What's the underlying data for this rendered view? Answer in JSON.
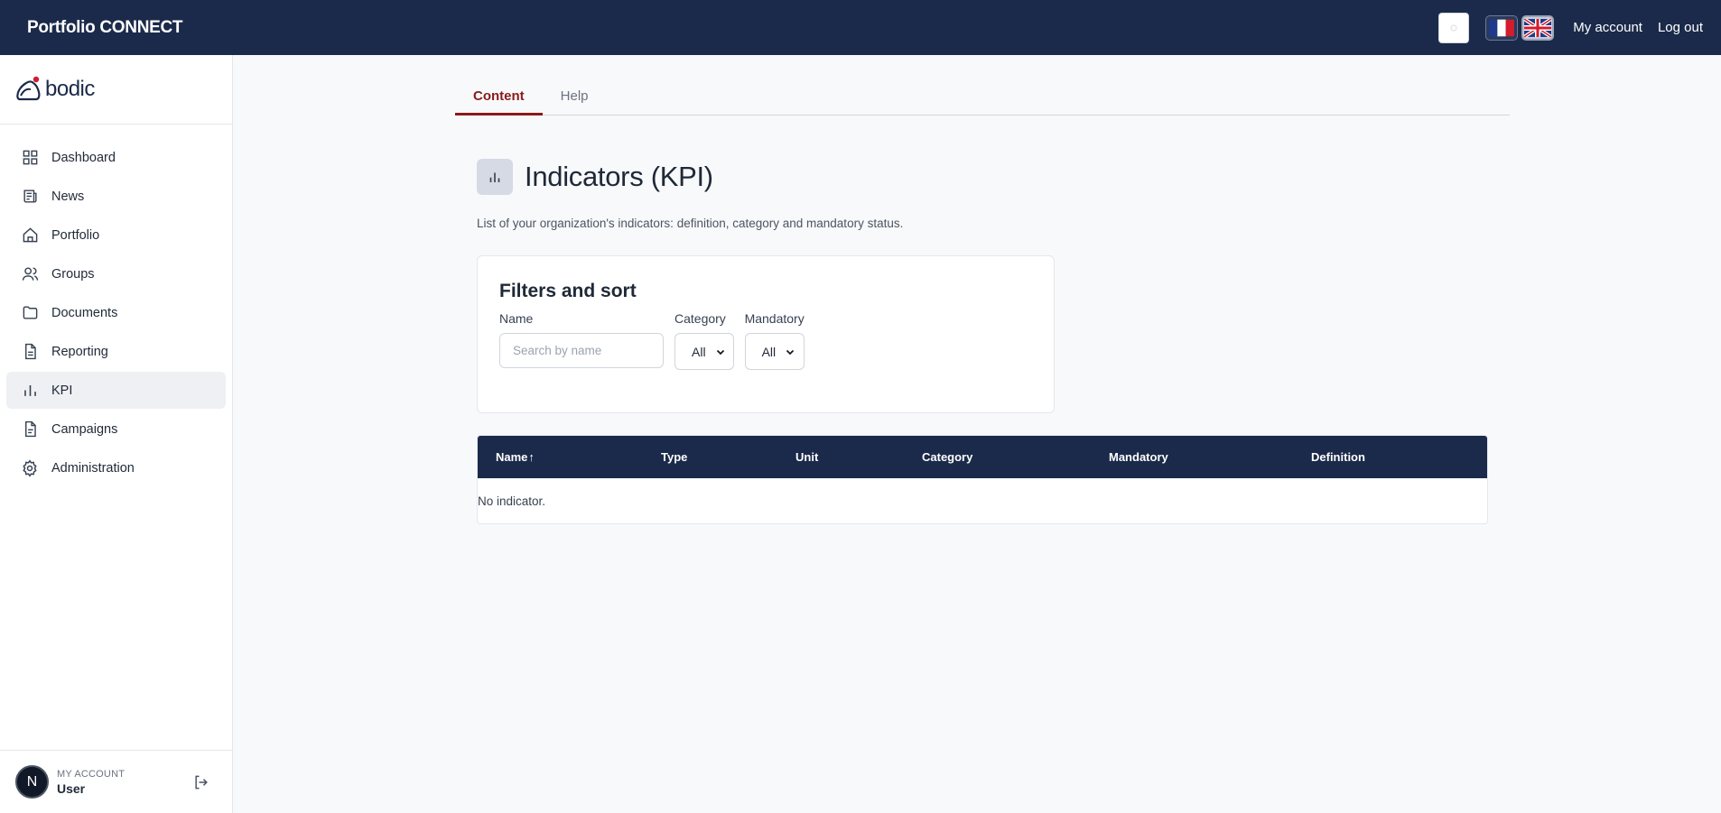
{
  "topbar": {
    "app_title": "Portfolio CONNECT",
    "my_account": "My account",
    "log_out": "Log out",
    "languages": [
      "fr",
      "en"
    ],
    "active_language": "en"
  },
  "sidebar": {
    "brand": "bodic",
    "items": [
      {
        "label": "Dashboard",
        "icon": "dashboard-grid-icon"
      },
      {
        "label": "News",
        "icon": "newspaper-icon"
      },
      {
        "label": "Portfolio",
        "icon": "home-icon"
      },
      {
        "label": "Groups",
        "icon": "users-icon"
      },
      {
        "label": "Documents",
        "icon": "folder-icon"
      },
      {
        "label": "Reporting",
        "icon": "file-text-icon"
      },
      {
        "label": "KPI",
        "icon": "bar-chart-icon",
        "active": true
      },
      {
        "label": "Campaigns",
        "icon": "file-icon"
      },
      {
        "label": "Administration",
        "icon": "gear-icon"
      }
    ],
    "account": {
      "avatar_initial": "N",
      "caption": "MY ACCOUNT",
      "name": "User"
    }
  },
  "tabs": [
    {
      "label": "Content",
      "active": true
    },
    {
      "label": "Help",
      "active": false
    }
  ],
  "page": {
    "title": "Indicators (KPI)",
    "description": "List of your organization's indicators: definition, category and mandatory status."
  },
  "filters": {
    "title": "Filters and sort",
    "name_label": "Name",
    "name_placeholder": "Search by name",
    "name_value": "",
    "category_label": "Category",
    "category_value": "All",
    "mandatory_label": "Mandatory",
    "mandatory_value": "All"
  },
  "table": {
    "columns": [
      "Name",
      "Type",
      "Unit",
      "Category",
      "Mandatory",
      "Definition"
    ],
    "sort_indicator": "↑",
    "empty_message": "No indicator."
  },
  "colors": {
    "navy": "#1b2a4a",
    "accent_red": "#8b1a1a",
    "page_bg": "#f8f9fb"
  }
}
